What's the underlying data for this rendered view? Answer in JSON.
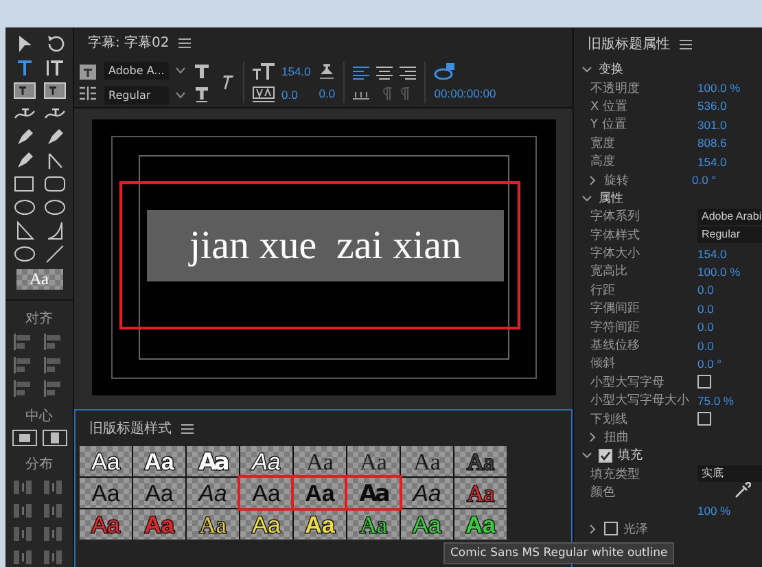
{
  "tools": [
    {
      "kind": "select",
      "selected": false
    },
    {
      "kind": "rotate",
      "selected": false
    },
    {
      "kind": "type",
      "selected": true
    },
    {
      "kind": "vtype",
      "selected": false
    },
    {
      "kind": "area",
      "selected": false
    },
    {
      "kind": "varea",
      "selected": false
    },
    {
      "kind": "path",
      "selected": false
    },
    {
      "kind": "vpath",
      "selected": false
    },
    {
      "kind": "pen",
      "selected": false
    },
    {
      "kind": "pen",
      "selected": false
    },
    {
      "kind": "pen",
      "selected": false
    },
    {
      "kind": "corner",
      "selected": false
    },
    {
      "kind": "rect",
      "selected": false
    },
    {
      "kind": "roundrect",
      "selected": false
    },
    {
      "kind": "ellipse",
      "selected": false
    },
    {
      "kind": "ellipse",
      "selected": false
    },
    {
      "kind": "wedge",
      "selected": false
    },
    {
      "kind": "arc",
      "selected": false
    },
    {
      "kind": "ellipse",
      "selected": false
    },
    {
      "kind": "line",
      "selected": false
    }
  ],
  "style_preview": "Aa",
  "align": {
    "title": "对齐"
  },
  "center": {
    "title": "中心"
  },
  "distribute": {
    "title": "分布"
  },
  "title_panel": {
    "title": "字幕: 字幕02",
    "font_family": "Adobe A...",
    "font_style": "Regular",
    "font_size": "154.0",
    "kerning": "0.0",
    "leading": "0.0",
    "timecode": "00:00:00:00"
  },
  "canvas": {
    "text": "jian xue  zai xian"
  },
  "styles_panel": {
    "title": "旧版标题样式",
    "swatches": [
      {
        "text": "Aa",
        "kind": "sans",
        "color": "#ffffff",
        "selected": false
      },
      {
        "text": "Aa",
        "kind": "bold",
        "color": "#ffffff",
        "selected": false
      },
      {
        "text": "Aa",
        "kind": "condensed",
        "color": "#ffffff",
        "selected": false
      },
      {
        "text": "Aa",
        "kind": "italic",
        "color": "#ffffff",
        "selected": false
      },
      {
        "text": "Aa",
        "kind": "serif",
        "color": "#1a1a1a",
        "selected": false
      },
      {
        "text": "Aa",
        "kind": "serif",
        "color": "#222222",
        "selected": false
      },
      {
        "text": "Aa",
        "kind": "serif",
        "color": "#1a1a1a",
        "selected": false
      },
      {
        "text": "Aa",
        "kind": "serif",
        "color": "#444444",
        "selected": false
      },
      {
        "text": "Aa",
        "kind": "sans",
        "color": "#111111",
        "selected": false
      },
      {
        "text": "Aa",
        "kind": "sans",
        "color": "#111111",
        "selected": false
      },
      {
        "text": "Aa",
        "kind": "italic",
        "color": "#111111",
        "selected": false
      },
      {
        "text": "Aa",
        "kind": "sans",
        "color": "#0c0c0c",
        "selected": true
      },
      {
        "text": "Aa",
        "kind": "bold",
        "color": "#0c0c0c",
        "selected": true
      },
      {
        "text": "Aa",
        "kind": "condensed",
        "color": "#0c0c0c",
        "selected": true
      },
      {
        "text": "Aa",
        "kind": "italic",
        "color": "#111111",
        "selected": false
      },
      {
        "text": "Aa",
        "kind": "serif",
        "color": "#d83030",
        "selected": false
      },
      {
        "text": "Aa",
        "kind": "sans",
        "color": "#e02828",
        "selected": false
      },
      {
        "text": "Aa",
        "kind": "bold",
        "color": "#e02828",
        "selected": false
      },
      {
        "text": "Aa",
        "kind": "serif",
        "color": "#e0c840",
        "selected": false
      },
      {
        "text": "Aa",
        "kind": "sans",
        "color": "#ecdc3c",
        "selected": false
      },
      {
        "text": "Aa",
        "kind": "bold",
        "color": "#ecdc3c",
        "selected": false
      },
      {
        "text": "Aa",
        "kind": "serif",
        "color": "#38d038",
        "selected": false
      },
      {
        "text": "Aa",
        "kind": "sans",
        "color": "#38d038",
        "selected": false
      },
      {
        "text": "Aa",
        "kind": "bold",
        "color": "#38d038",
        "selected": false
      }
    ]
  },
  "tooltip": "Comic Sans MS Regular white outline",
  "properties": {
    "title": "旧版标题属性",
    "rows": [
      {
        "kind": "section",
        "label": "变换",
        "expanded": true
      },
      {
        "kind": "value",
        "label": "不透明度",
        "value": "100.0 %"
      },
      {
        "kind": "value",
        "label": "X 位置",
        "value": "536.0"
      },
      {
        "kind": "value",
        "label": "Y 位置",
        "value": "301.0"
      },
      {
        "kind": "value",
        "label": "宽度",
        "value": "808.6"
      },
      {
        "kind": "value",
        "label": "高度",
        "value": "154.0"
      },
      {
        "kind": "group",
        "label": "旋转",
        "value": "0.0 °",
        "expanded": false
      },
      {
        "kind": "section",
        "label": "属性",
        "expanded": true
      },
      {
        "kind": "dropdown",
        "label": "字体系列",
        "value": "Adobe Arabi"
      },
      {
        "kind": "dropdown",
        "label": "字体样式",
        "value": "Regular"
      },
      {
        "kind": "value",
        "label": "字体大小",
        "value": "154.0"
      },
      {
        "kind": "value",
        "label": "宽高比",
        "value": "100.0 %"
      },
      {
        "kind": "value",
        "label": "行距",
        "value": "0.0"
      },
      {
        "kind": "value",
        "label": "字偶间距",
        "value": "0.0"
      },
      {
        "kind": "value",
        "label": "字符间距",
        "value": "0.0"
      },
      {
        "kind": "value",
        "label": "基线位移",
        "value": "0.0"
      },
      {
        "kind": "value",
        "label": "倾斜",
        "value": "0.0 °"
      },
      {
        "kind": "checkbox",
        "label": "小型大写字母",
        "checked": false
      },
      {
        "kind": "value",
        "label": "小型大写字母大小",
        "value": "75.0 %"
      },
      {
        "kind": "checkbox",
        "label": "下划线",
        "checked": false
      },
      {
        "kind": "group",
        "label": "扭曲",
        "expanded": false
      },
      {
        "kind": "checksection",
        "label": "填充",
        "expanded": true,
        "checked": true
      },
      {
        "kind": "dropdown",
        "label": "填充类型",
        "value": "实底"
      },
      {
        "kind": "color",
        "label": "颜色"
      },
      {
        "kind": "value",
        "value": "100 %"
      },
      {
        "kind": "checkgroup",
        "label": "光泽",
        "expanded": false,
        "checked": false
      }
    ]
  }
}
